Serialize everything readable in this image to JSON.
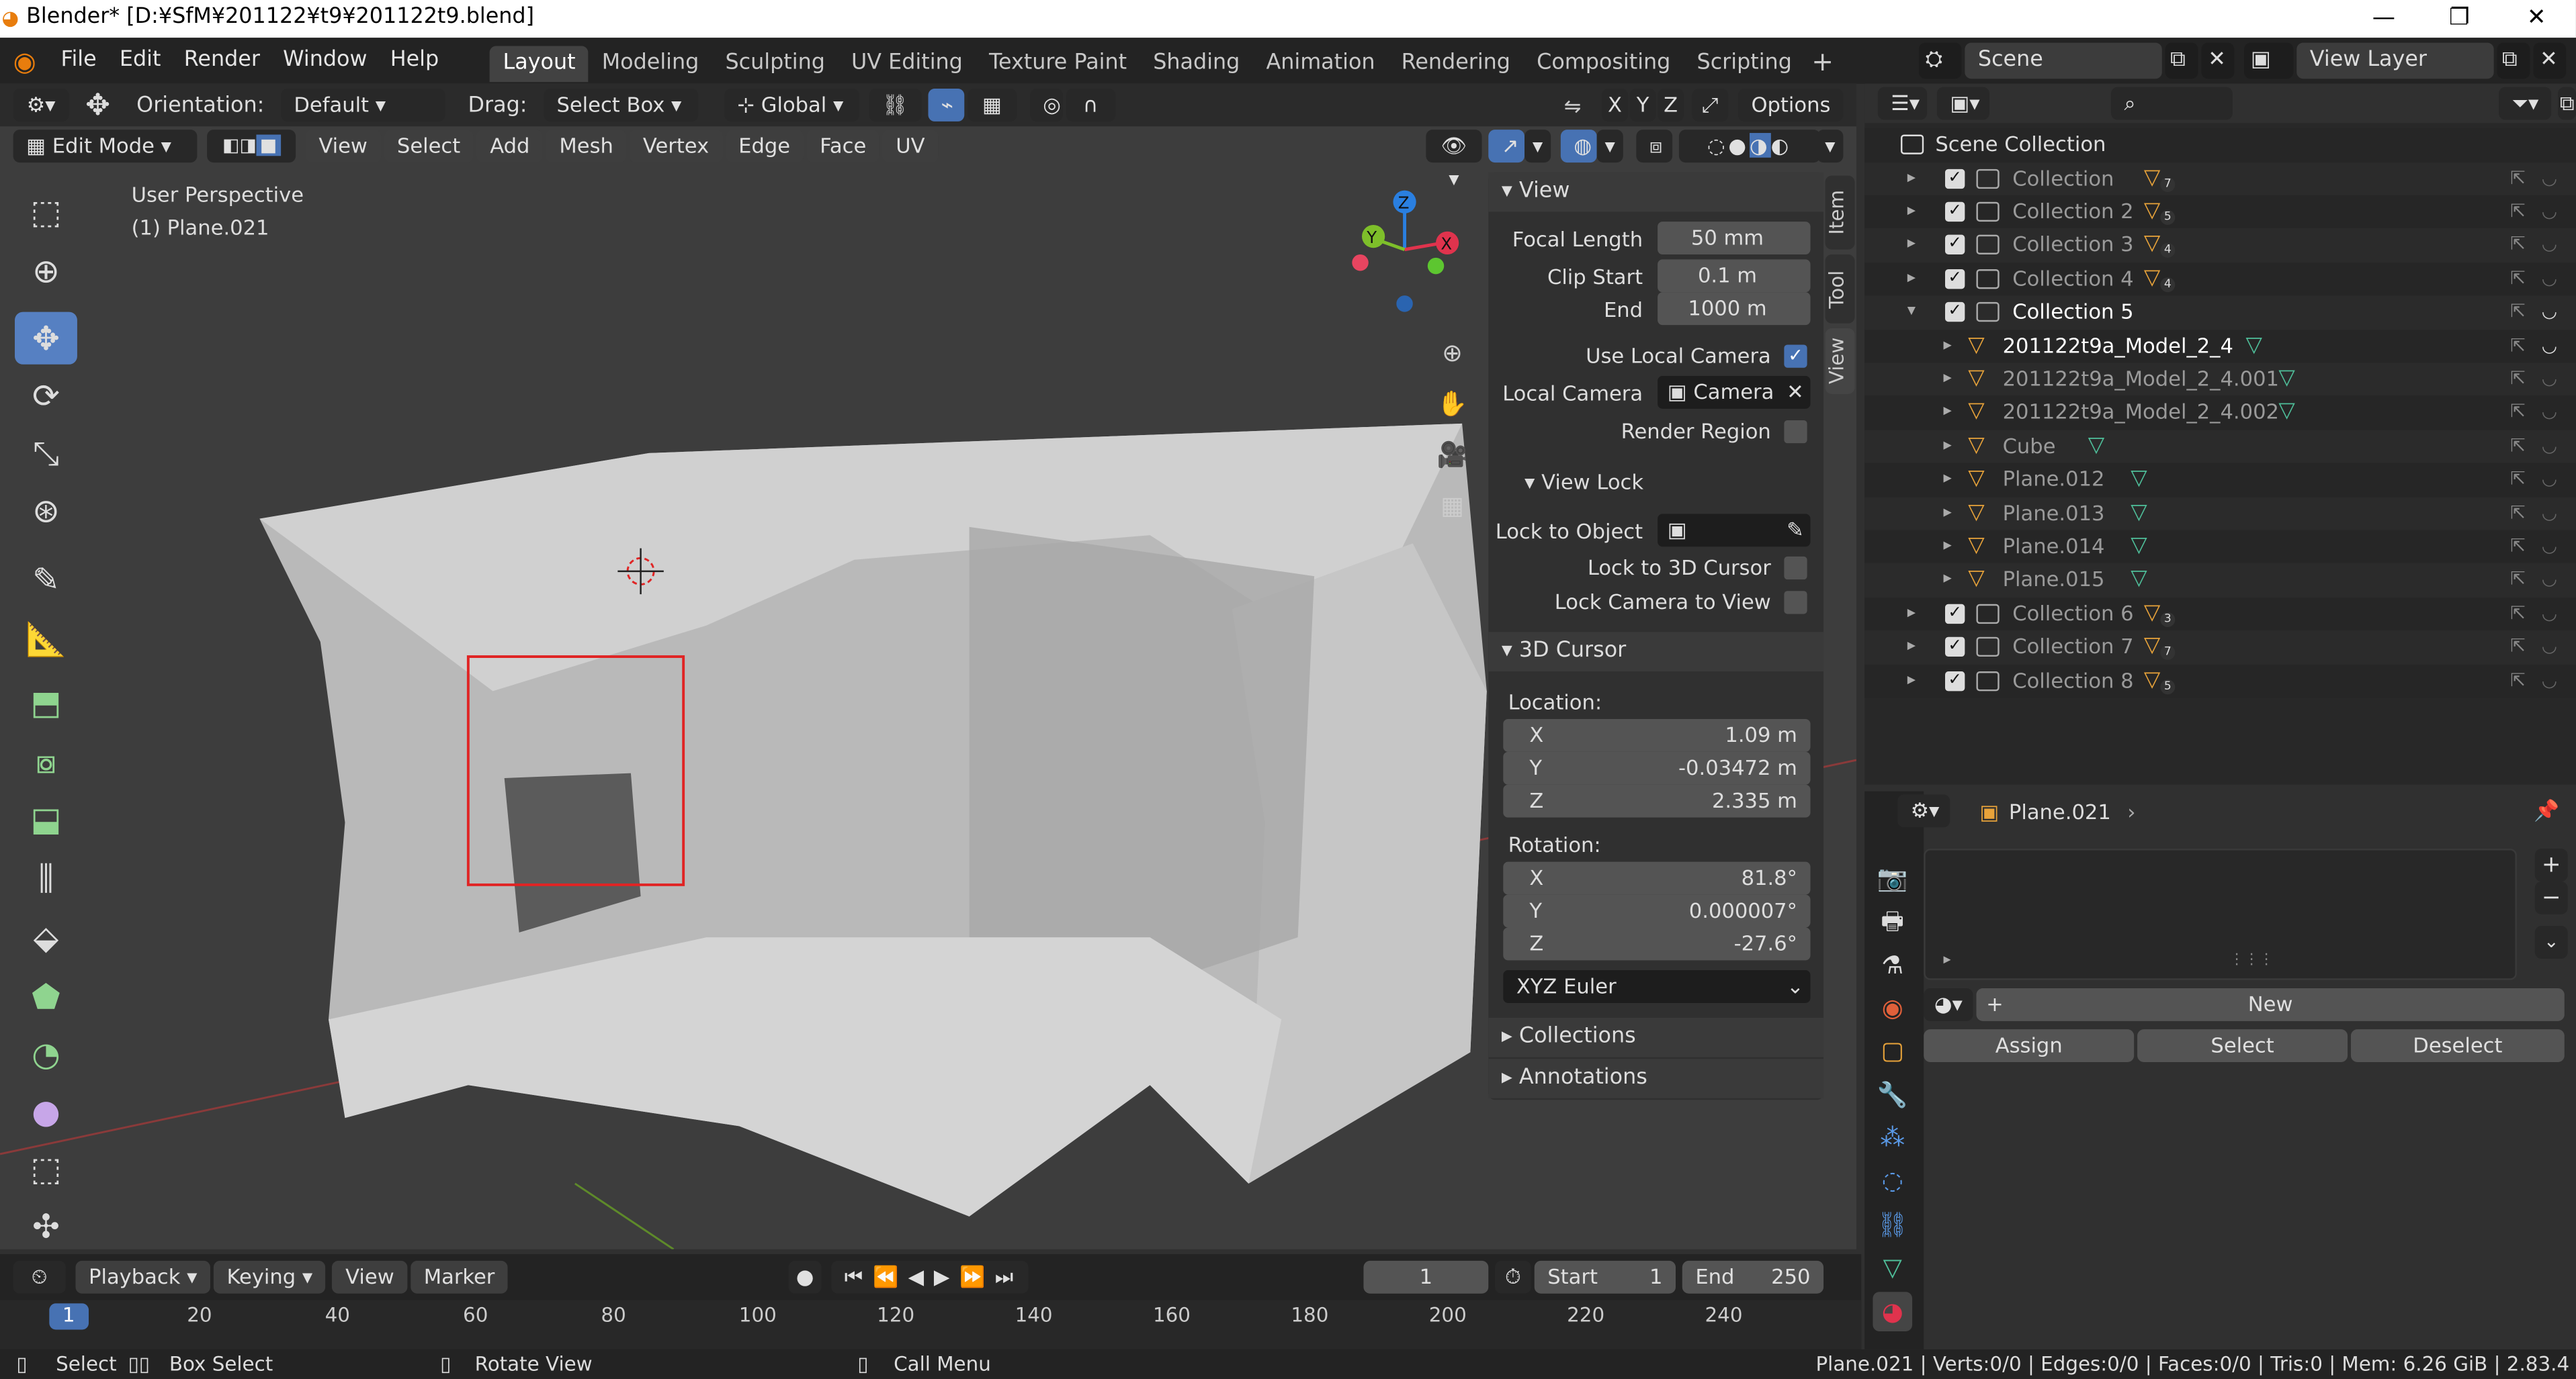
{
  "window": {
    "title": "Blender* [D:¥SfM¥201122¥t9¥201122t9.blend]",
    "min": "—",
    "max": "❐",
    "close": "✕"
  },
  "menus": [
    "File",
    "Edit",
    "Render",
    "Window",
    "Help"
  ],
  "workspaces": [
    "Layout",
    "Modeling",
    "Sculpting",
    "UV Editing",
    "Texture Paint",
    "Shading",
    "Animation",
    "Rendering",
    "Compositing",
    "Scripting"
  ],
  "scene": {
    "label": "Scene",
    "view_layer": "View Layer"
  },
  "tool_header": {
    "orientation_label": "Orientation:",
    "orientation_value": "Default",
    "drag_label": "Drag:",
    "drag_value": "Select Box",
    "transform": "Global",
    "axes": [
      "X",
      "Y",
      "Z"
    ],
    "options": "Options"
  },
  "viewport_header": {
    "mode": "Edit Mode",
    "menus": [
      "View",
      "Select",
      "Add",
      "Mesh",
      "Vertex",
      "Edge",
      "Face",
      "UV"
    ]
  },
  "viewport": {
    "perspective": "User Perspective",
    "object": "(1) Plane.021",
    "gizmo": {
      "x": "X",
      "y": "Y",
      "z": "Z"
    }
  },
  "npanel": {
    "tabs": [
      "Item",
      "Tool",
      "View"
    ],
    "view_section": "View",
    "focal_length_label": "Focal Length",
    "focal_length": "50 mm",
    "clip_start_label": "Clip Start",
    "clip_start": "0.1 m",
    "end_label": "End",
    "end": "1000 m",
    "use_local_camera": "Use Local Camera",
    "local_camera_label": "Local Camera",
    "local_camera": "Camera",
    "render_region": "Render Region",
    "view_lock": "View Lock",
    "lock_to_object": "Lock to Object",
    "lock_to_cursor": "Lock to 3D Cursor",
    "lock_camera": "Lock Camera to View",
    "cursor_section": "3D Cursor",
    "location_label": "Location:",
    "loc": [
      {
        "axis": "X",
        "value": "1.09 m"
      },
      {
        "axis": "Y",
        "value": "-0.03472 m"
      },
      {
        "axis": "Z",
        "value": "2.335 m"
      }
    ],
    "rotation_label": "Rotation:",
    "rot": [
      {
        "axis": "X",
        "value": "81.8°"
      },
      {
        "axis": "Y",
        "value": "0.000007°"
      },
      {
        "axis": "Z",
        "value": "-27.6°"
      }
    ],
    "rot_mode": "XYZ Euler",
    "collections": "Collections",
    "annotations": "Annotations"
  },
  "outliner": {
    "root": "Scene Collection",
    "rows": [
      {
        "name": "Collection",
        "badge": "7"
      },
      {
        "name": "Collection 2",
        "badge": "5"
      },
      {
        "name": "Collection 3",
        "badge": "4"
      },
      {
        "name": "Collection 4",
        "badge": "4"
      },
      {
        "name": "Collection 5",
        "badge": ""
      },
      {
        "name": "201122t9a_Model_2_4",
        "badge": ""
      },
      {
        "name": "201122t9a_Model_2_4.001",
        "badge": ""
      },
      {
        "name": "201122t9a_Model_2_4.002",
        "badge": ""
      },
      {
        "name": "Cube",
        "badge": ""
      },
      {
        "name": "Plane.012",
        "badge": ""
      },
      {
        "name": "Plane.013",
        "badge": ""
      },
      {
        "name": "Plane.014",
        "badge": ""
      },
      {
        "name": "Plane.015",
        "badge": ""
      },
      {
        "name": "Collection 6",
        "badge": "3"
      },
      {
        "name": "Collection 7",
        "badge": "7"
      },
      {
        "name": "Collection 8",
        "badge": "5"
      }
    ]
  },
  "properties": {
    "object": "Plane.021",
    "new": "New",
    "assign": "Assign",
    "select": "Select",
    "deselect": "Deselect"
  },
  "timeline": {
    "menus": [
      "Playback",
      "Keying",
      "View",
      "Marker"
    ],
    "current": "1",
    "start_label": "Start",
    "start": "1",
    "end_label": "End",
    "end": "250",
    "ticks": [
      "1",
      "20",
      "40",
      "60",
      "80",
      "100",
      "120",
      "140",
      "160",
      "180",
      "200",
      "220",
      "240"
    ]
  },
  "status": {
    "select": "Select",
    "box_select": "Box Select",
    "rotate": "Rotate View",
    "call_menu": "Call Menu",
    "stats": "Plane.021 | Verts:0/0 | Edges:0/0 | Faces:0/0 | Tris:0 | Mem: 6.26 GiB | 2.83.4"
  }
}
